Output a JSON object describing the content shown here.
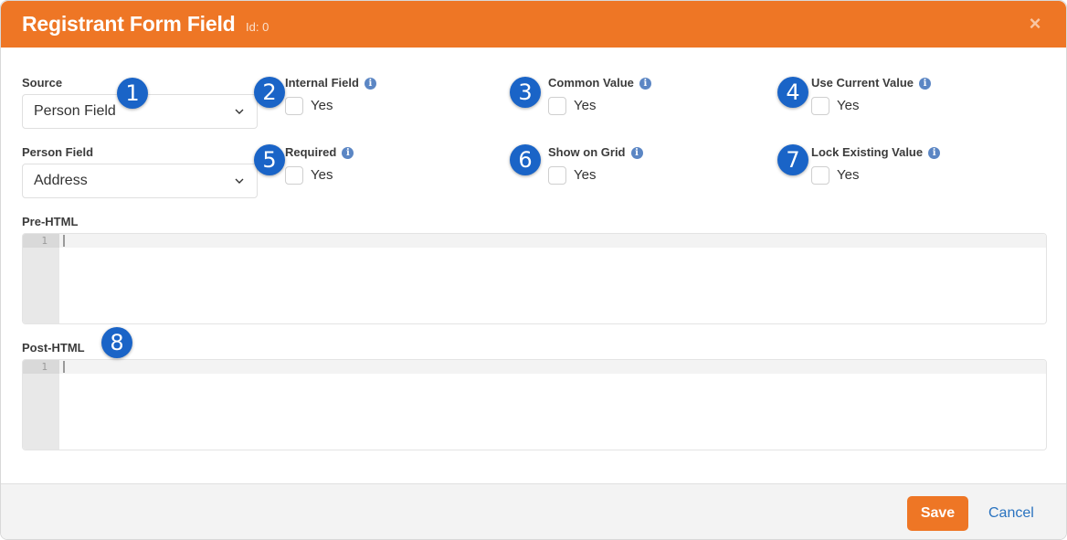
{
  "dialog": {
    "title": "Registrant Form Field",
    "id_label": "Id: 0",
    "close_icon": "×",
    "colors": {
      "header": "#ee7625",
      "badge": "#1a64c7",
      "info": "#5b86c4",
      "link": "#2a73c0"
    }
  },
  "form": {
    "source": {
      "label": "Source",
      "value": "Person Field"
    },
    "person_field": {
      "label": "Person Field",
      "value": "Address"
    },
    "checkboxes": [
      {
        "label": "Internal Field",
        "option": "Yes",
        "checked": false
      },
      {
        "label": "Common Value",
        "option": "Yes",
        "checked": false
      },
      {
        "label": "Use Current Value",
        "option": "Yes",
        "checked": false
      },
      {
        "label": "Required",
        "option": "Yes",
        "checked": false
      },
      {
        "label": "Show on Grid",
        "option": "Yes",
        "checked": false
      },
      {
        "label": "Lock Existing Value",
        "option": "Yes",
        "checked": false
      }
    ],
    "pre_html": {
      "label": "Pre-HTML",
      "line_number": "1",
      "content": ""
    },
    "post_html": {
      "label": "Post-HTML",
      "line_number": "1",
      "content": ""
    }
  },
  "badges": [
    "1",
    "2",
    "3",
    "4",
    "5",
    "6",
    "7",
    "8"
  ],
  "info_icon": "i",
  "footer": {
    "save_label": "Save",
    "cancel_label": "Cancel"
  }
}
